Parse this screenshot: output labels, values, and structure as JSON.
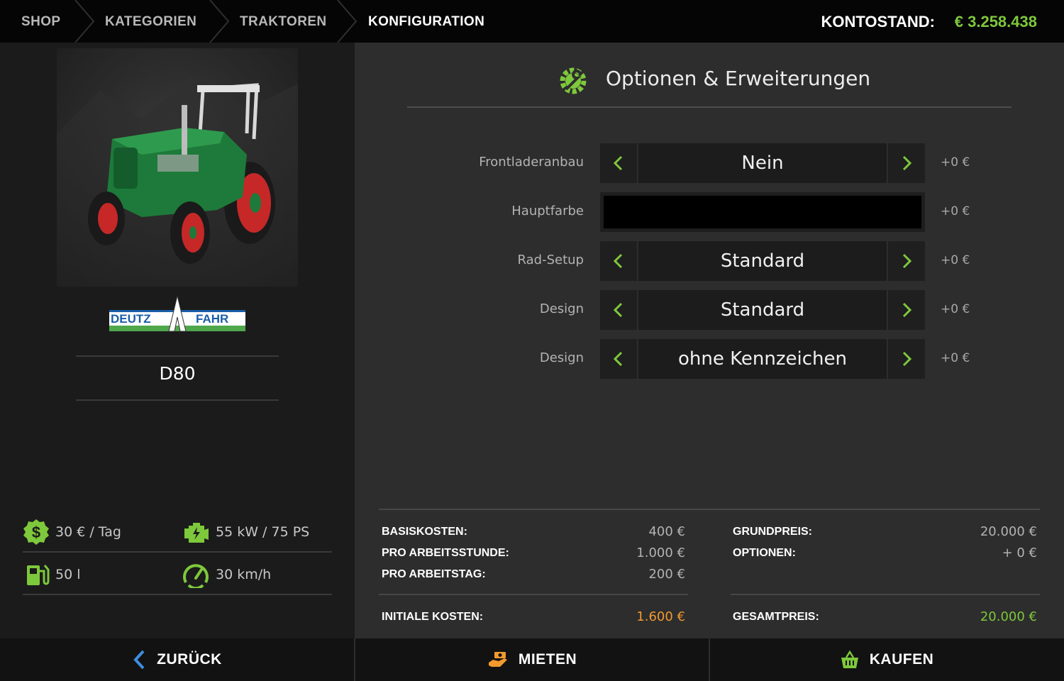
{
  "breadcrumb": {
    "items": [
      "SHOP",
      "KATEGORIEN",
      "TRAKTOREN"
    ],
    "active": "KONFIGURATION"
  },
  "account": {
    "label": "KONTOSTAND:",
    "value": "€ 3.258.438"
  },
  "vehicle": {
    "brand_logo": "DEUTZ FAHR",
    "model": "D80",
    "specs": {
      "daily_cost": "30 € / Tag",
      "power": "55 kW / 75 PS",
      "fuel": "50 l",
      "speed": "30 km/h"
    }
  },
  "options": {
    "title": "Optionen & Erweiterungen",
    "rows": [
      {
        "label": "Frontladeranbau",
        "value": "Nein",
        "price": "+0 €"
      },
      {
        "label": "Hauptfarbe",
        "value": "",
        "price": "+0 €",
        "swatch": "#000000"
      },
      {
        "label": "Rad-Setup",
        "value": "Standard",
        "price": "+0 €"
      },
      {
        "label": "Design",
        "value": "Standard",
        "price": "+0 €"
      },
      {
        "label": "Design",
        "value": "ohne Kennzeichen",
        "price": "+0 €"
      }
    ]
  },
  "lease": {
    "base_label": "BASISKOSTEN:",
    "base_value": "400 €",
    "hour_label": "PRO ARBEITSSTUNDE:",
    "hour_value": "1.000 €",
    "day_label": "PRO ARBEITSTAG:",
    "day_value": "200 €",
    "initial_label": "INITIALE KOSTEN:",
    "initial_value": "1.600 €"
  },
  "purchase": {
    "base_label": "GRUNDPREIS:",
    "base_value": "20.000 €",
    "options_label": "OPTIONEN:",
    "options_value": "+ 0 €",
    "total_label": "GESAMTPREIS:",
    "total_value": "20.000 €"
  },
  "actions": {
    "back": "ZURÜCK",
    "lease": "MIETEN",
    "buy": "KAUFEN"
  },
  "colors": {
    "accent": "#7ec83c",
    "orange": "#f29a2e",
    "tractor_green": "#1d7a3a",
    "wheel_red": "#c62828"
  }
}
